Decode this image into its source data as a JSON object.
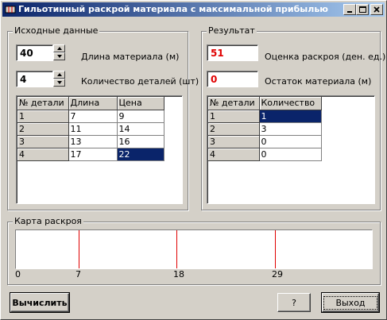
{
  "window": {
    "title": "Гильотинный раскрой материала с максимальной прибылью"
  },
  "input_group": {
    "title": "Исходные данные",
    "length_value": "40",
    "length_label": "Длина материала (м)",
    "count_value": "4",
    "count_label": "Количество деталей (шт)",
    "columns": [
      "№ детали",
      "Длина",
      "Цена"
    ],
    "rows": [
      [
        "1",
        "7",
        "9"
      ],
      [
        "2",
        "11",
        "14"
      ],
      [
        "3",
        "13",
        "16"
      ],
      [
        "4",
        "17",
        "22"
      ]
    ]
  },
  "result_group": {
    "title": "Результат",
    "score_value": "51",
    "score_label": "Оценка раскроя (ден. ед.)",
    "rest_value": "0",
    "rest_label": "Остаток материала (м)",
    "columns": [
      "№ детали",
      "Количество"
    ],
    "rows": [
      [
        "1",
        "1"
      ],
      [
        "2",
        "3"
      ],
      [
        "3",
        "0"
      ],
      [
        "4",
        "0"
      ]
    ]
  },
  "map_group": {
    "title": "Карта раскроя",
    "total_length": 40,
    "cuts": [
      7,
      18,
      29
    ],
    "ticks": [
      "0",
      "7",
      "18",
      "29"
    ],
    "cut_color": "#e00000"
  },
  "buttons": {
    "calculate": "Вычислить",
    "help": "?",
    "exit": "Выход"
  }
}
